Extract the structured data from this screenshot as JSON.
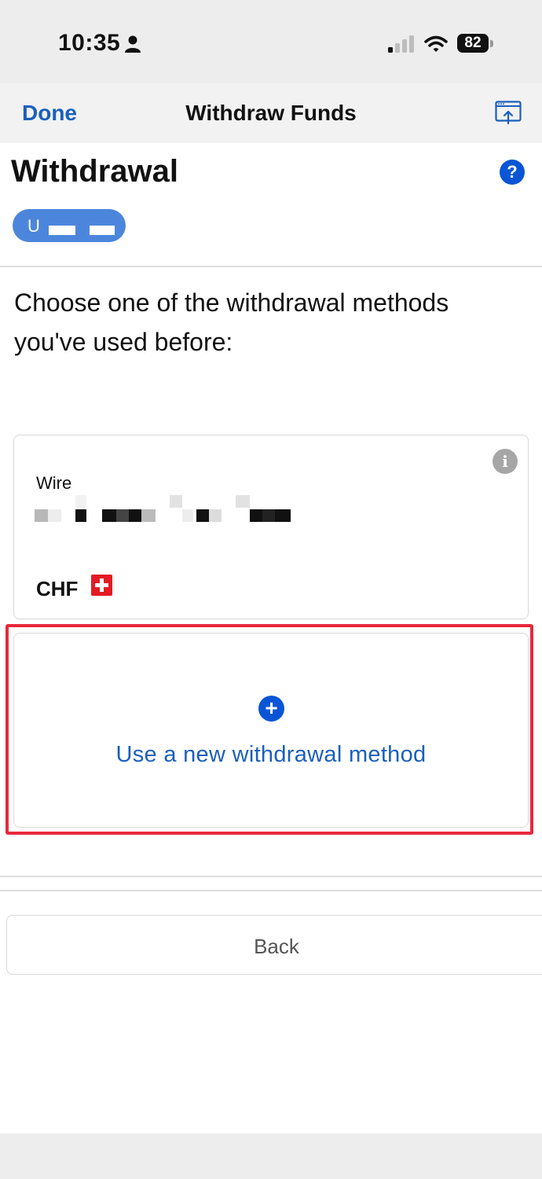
{
  "status_bar": {
    "time": "10:35",
    "battery": "82"
  },
  "nav": {
    "done_label": "Done",
    "title": "Withdraw Funds"
  },
  "page": {
    "title": "Withdrawal",
    "account_initial": "U",
    "prompt": "Choose one of the withdrawal methods you've used before:"
  },
  "saved_method": {
    "type": "Wire",
    "currency": "CHF"
  },
  "new_method": {
    "label": "Use a new withdrawal method"
  },
  "footer": {
    "back_label": "Back"
  },
  "colors": {
    "accent": "#1b5fbd",
    "icon_blue": "#0a55d6",
    "highlight": "#e8283c",
    "pill": "#4c86dc"
  },
  "icons": [
    "person-icon",
    "signal-icon",
    "wifi-icon",
    "share-icon",
    "help-icon",
    "info-icon",
    "swiss-flag-icon",
    "plus-icon"
  ]
}
